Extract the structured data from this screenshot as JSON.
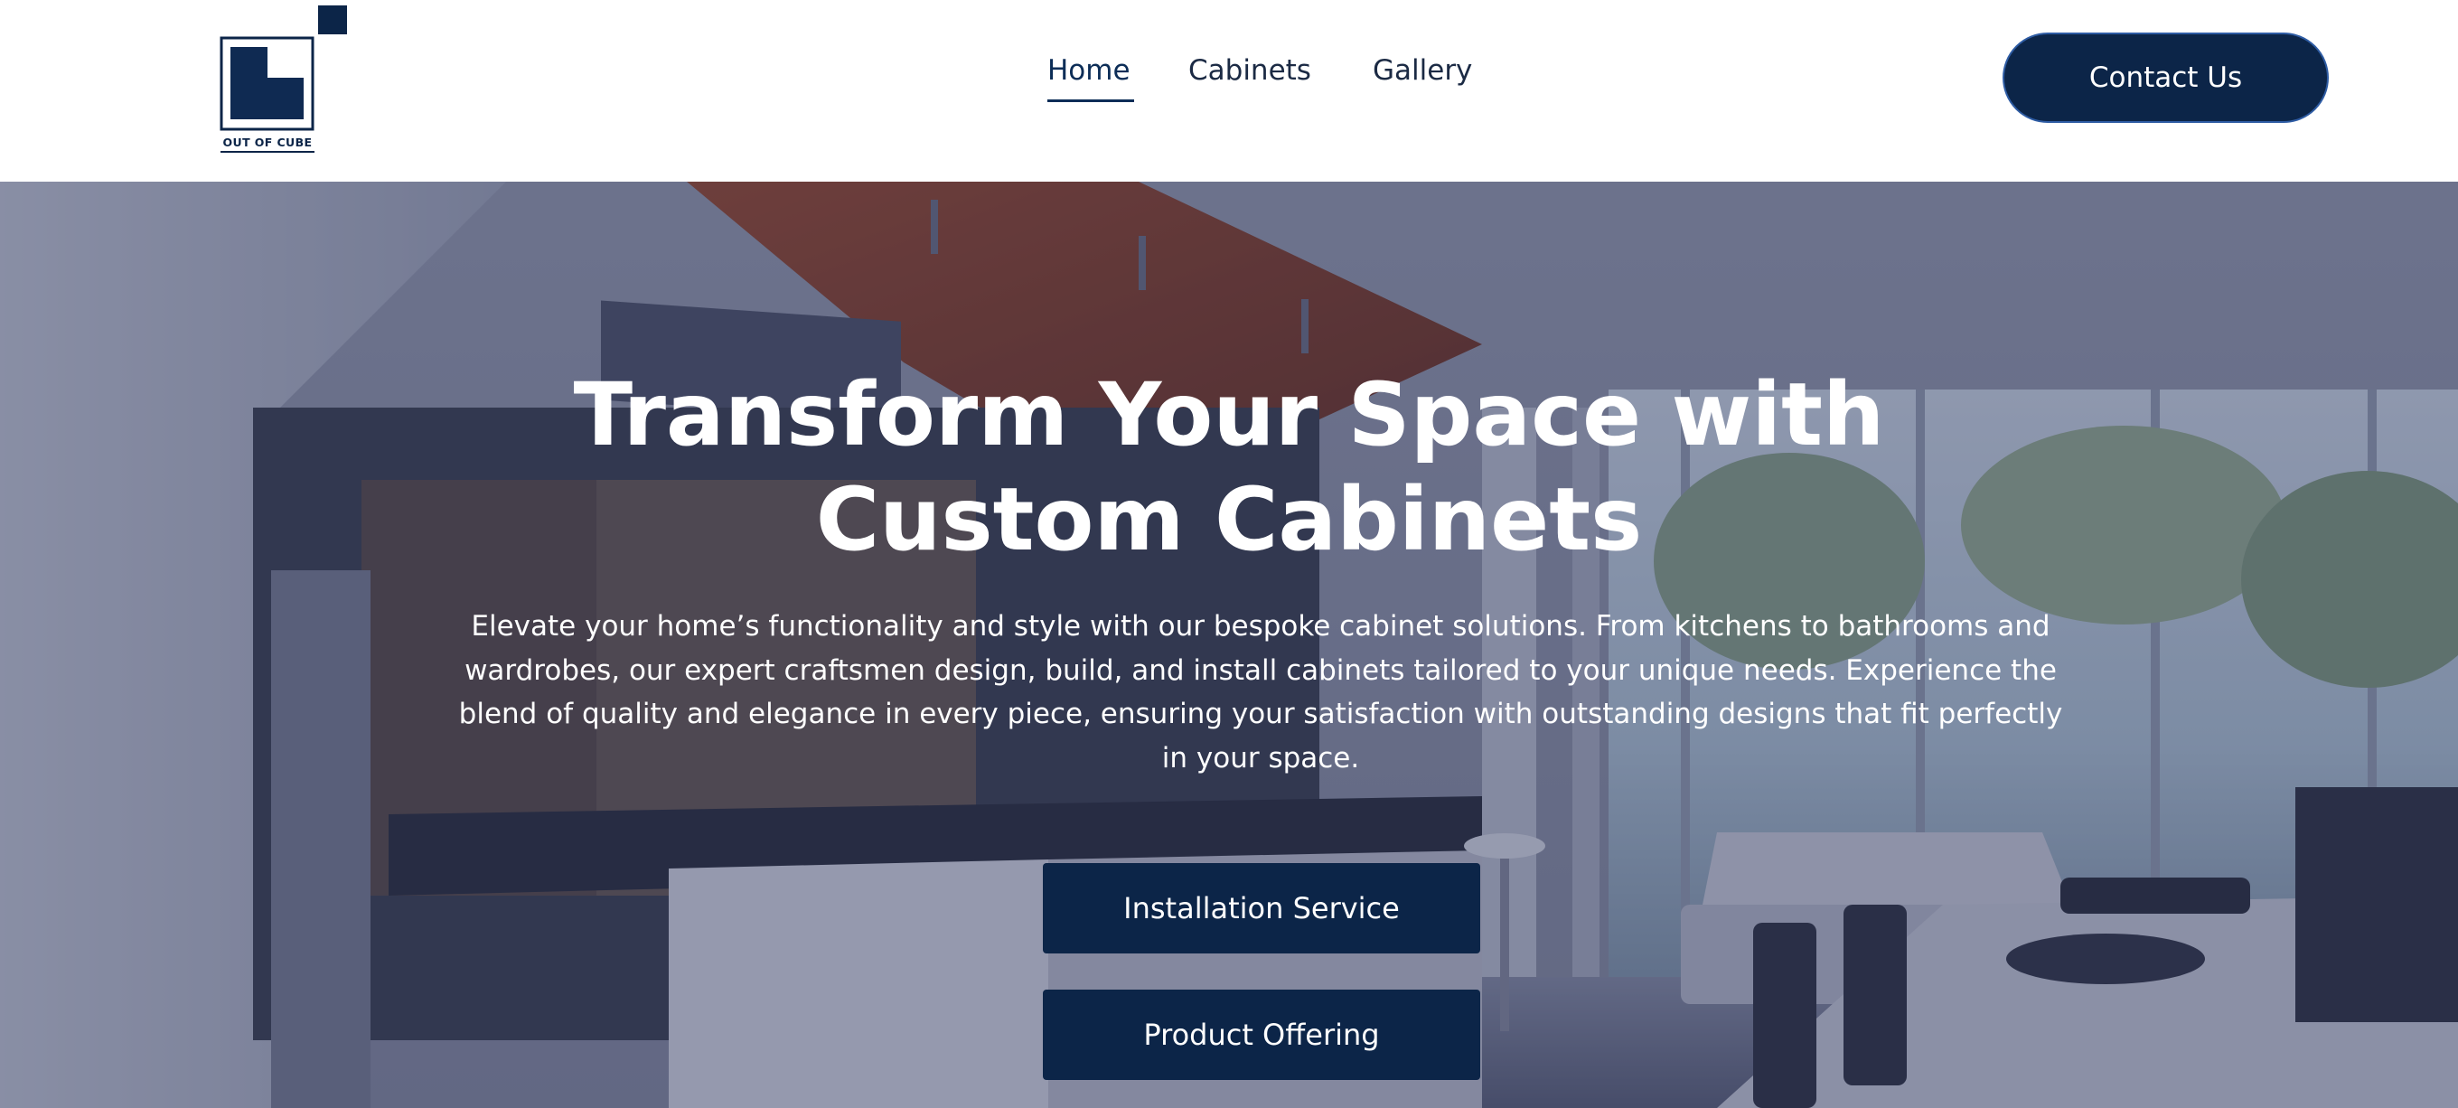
{
  "header": {
    "logo": {
      "text": "OUT OF CUBE",
      "colors": {
        "primary": "#0c2548",
        "dark": "#081a36"
      }
    },
    "nav": [
      {
        "label": "Home",
        "active": true
      },
      {
        "label": "Cabinets",
        "active": false
      },
      {
        "label": "Gallery",
        "active": false
      }
    ],
    "contact_label": "Contact Us"
  },
  "hero": {
    "title": "Transform Your Space with Custom Cabinets",
    "description": "Elevate your home’s functionality and style with our bespoke cabinet solutions. From kitchens to bathrooms and wardrobes, our expert craftsmen design, build, and install cabinets tailored to your unique needs. Experience the blend of quality and elegance in every piece, ensuring your satisfaction with outstanding designs that fit perfectly in your space.",
    "buttons": {
      "installation": "Installation Service",
      "product": "Product Offering"
    },
    "background": "kitchen-living-room-photo"
  },
  "colors": {
    "brand_navy": "#0c2548",
    "nav_text": "#1b2a44",
    "hero_overlay": "rgba(40,48,86,0.42)",
    "white": "#ffffff"
  }
}
